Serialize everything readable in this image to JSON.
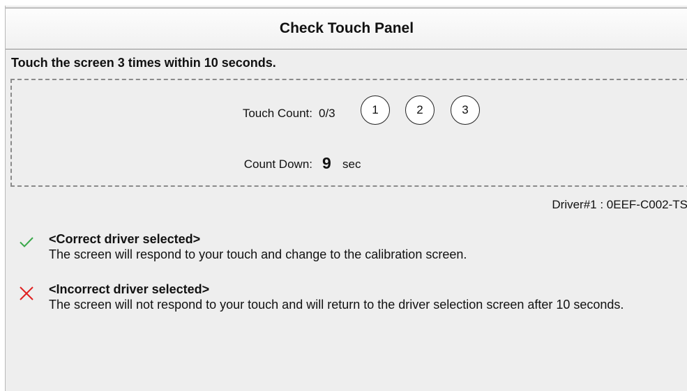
{
  "window": {
    "title": "Check Touch Panel"
  },
  "instruction": "Touch the screen 3 times within 10 seconds.",
  "touch": {
    "label": "Touch Count:",
    "value": "0/3",
    "circles": [
      "1",
      "2",
      "3"
    ]
  },
  "countdown": {
    "label": "Count Down:",
    "value": "9",
    "unit": "sec"
  },
  "driver": {
    "text": "Driver#1 : 0EEF-C002-TS"
  },
  "messages": {
    "correct": {
      "icon": "checkmark-icon",
      "color": "#3aa84a",
      "title": "<Correct driver selected>",
      "body": "The screen will respond to your touch and change to the calibration screen."
    },
    "incorrect": {
      "icon": "cross-icon",
      "color": "#e02020",
      "title": "<Incorrect driver selected>",
      "body": "The screen will not respond to your touch and will return to the driver selection screen after 10 seconds."
    }
  }
}
